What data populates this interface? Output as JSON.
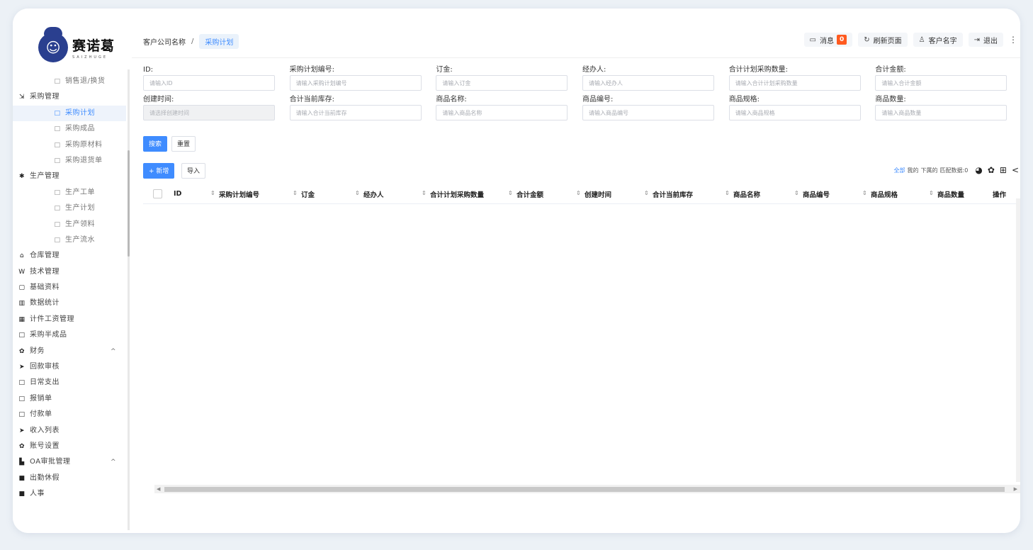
{
  "brand": {
    "name": "赛诺葛",
    "sub": "SAIZHUGE"
  },
  "sidebar": {
    "items": [
      {
        "label": "销售退/换货",
        "level": 2,
        "icon": "□",
        "icon_name": "folder-icon"
      },
      {
        "label": "采购管理",
        "level": 1,
        "icon": "⇲",
        "icon_name": "cart-icon"
      },
      {
        "label": "采购计划",
        "level": 2,
        "icon": "□",
        "icon_name": "folder-icon",
        "active": true
      },
      {
        "label": "采购成品",
        "level": 2,
        "icon": "□",
        "icon_name": "folder-icon"
      },
      {
        "label": "采购原材料",
        "level": 2,
        "icon": "□",
        "icon_name": "folder-icon"
      },
      {
        "label": "采购退货单",
        "level": 2,
        "icon": "□",
        "icon_name": "folder-icon"
      },
      {
        "label": "生产管理",
        "level": 1,
        "icon": "✱",
        "icon_name": "asterisk-icon"
      },
      {
        "label": "生产工单",
        "level": 2,
        "icon": "□",
        "icon_name": "folder-icon"
      },
      {
        "label": "生产计划",
        "level": 2,
        "icon": "□",
        "icon_name": "folder-icon"
      },
      {
        "label": "生产领料",
        "level": 2,
        "icon": "□",
        "icon_name": "folder-icon"
      },
      {
        "label": "生产流水",
        "level": 2,
        "icon": "□",
        "icon_name": "folder-icon"
      },
      {
        "label": "仓库管理",
        "level": 1,
        "icon": "⌂",
        "icon_name": "warehouse-icon"
      },
      {
        "label": "技术管理",
        "level": 1,
        "icon": "W",
        "icon_name": "wiki-icon"
      },
      {
        "label": "基础资料",
        "level": 1,
        "icon": "▢",
        "icon_name": "note-icon"
      },
      {
        "label": "数据统计",
        "level": 1,
        "icon": "▥",
        "icon_name": "bar-chart-icon"
      },
      {
        "label": "计件工资管理",
        "level": 1,
        "icon": "▦",
        "icon_name": "calculator-icon"
      },
      {
        "label": "采购半成品",
        "level": 1,
        "icon": "□",
        "icon_name": "folder-icon"
      },
      {
        "label": "财务",
        "level": 1,
        "icon": "✿",
        "icon_name": "gear-icon",
        "caret": "^"
      },
      {
        "label": "回款审核",
        "level": 1,
        "icon": "➤",
        "icon_name": "send-icon"
      },
      {
        "label": "日常支出",
        "level": 1,
        "icon": "□",
        "icon_name": "folder-icon"
      },
      {
        "label": "报销单",
        "level": 1,
        "icon": "□",
        "icon_name": "folder-icon"
      },
      {
        "label": "付款单",
        "level": 1,
        "icon": "□",
        "icon_name": "folder-icon"
      },
      {
        "label": "收入列表",
        "level": 1,
        "icon": "➤",
        "icon_name": "send-icon"
      },
      {
        "label": "账号设置",
        "level": 1,
        "icon": "✿",
        "icon_name": "gear-icon"
      },
      {
        "label": "OA审批管理",
        "level": 1,
        "icon": "▙",
        "icon_name": "org-icon",
        "caret": "^"
      },
      {
        "label": "出勤休假",
        "level": 1,
        "icon": "■",
        "icon_name": "folder-filled-icon"
      },
      {
        "label": "人事",
        "level": 1,
        "icon": "■",
        "icon_name": "folder-filled-icon"
      }
    ]
  },
  "topbar": {
    "breadcrumb": {
      "company": "客户公司名称",
      "separator": "/",
      "current": "采购计划"
    },
    "messages": {
      "label": "消息",
      "count": "0"
    },
    "refresh_label": "刷新页面",
    "user_label": "客户名字",
    "logout_label": "退出",
    "more": "⋮"
  },
  "filters": {
    "rows": [
      [
        {
          "label": "ID:",
          "placeholder": "请输入ID"
        },
        {
          "label": "采购计划编号:",
          "placeholder": "请输入采购计划编号"
        },
        {
          "label": "订金:",
          "placeholder": "请输入订金"
        },
        {
          "label": "经办人:",
          "placeholder": "请输入经办人"
        },
        {
          "label": "合计计划采购数量:",
          "placeholder": "请输入合计计划采购数量"
        },
        {
          "label": "合计金额:",
          "placeholder": "请输入合计金额"
        }
      ],
      [
        {
          "label": "创建时间:",
          "placeholder": "请选择创建时间",
          "disabled": true
        },
        {
          "label": "合计当前库存:",
          "placeholder": "请输入合计当前库存"
        },
        {
          "label": "商品名称:",
          "placeholder": "请输入商品名称"
        },
        {
          "label": "商品编号:",
          "placeholder": "请输入商品编号"
        },
        {
          "label": "商品规格:",
          "placeholder": "请输入商品规格"
        },
        {
          "label": "商品数量:",
          "placeholder": "请输入商品数量"
        }
      ]
    ]
  },
  "actions": {
    "search_label": "搜索",
    "reset_label": "重置",
    "add_label": "+ 新增",
    "import_label": "导入"
  },
  "view_tools": {
    "all": "全部",
    "mine": "我的",
    "sub": "下属的",
    "matched": "匹配数据:0"
  },
  "table": {
    "columns": [
      "ID",
      "采购计划编号",
      "订金",
      "经办人",
      "合计计划采购数量",
      "合计金额",
      "创建时间",
      "合计当前库存",
      "商品名称",
      "商品编号",
      "商品规格",
      "商品数量",
      "操作"
    ]
  },
  "colors": {
    "accent": "#3f8cff",
    "badge": "#ff5a1f"
  }
}
